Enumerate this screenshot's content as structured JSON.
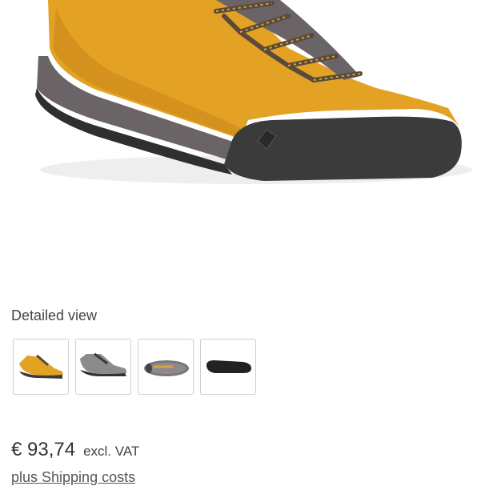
{
  "product": {
    "main_image_icon": "shoe-image",
    "colors": {
      "suede": "#E3A224",
      "suede_shadow": "#C9861A",
      "rubber": "#3B3B3B",
      "midsole": "#6B6466",
      "lace": "#5A4A3A",
      "lace_accent": "#D6A53A"
    }
  },
  "gallery": {
    "title": "Detailed view",
    "thumbnails": [
      {
        "icon": "shoe-side-yellow-thumbnail"
      },
      {
        "icon": "shoe-side-gray-thumbnail"
      },
      {
        "icon": "shoe-top-thumbnail"
      },
      {
        "icon": "shoe-sole-thumbnail"
      }
    ]
  },
  "pricing": {
    "price": "€ 93,74",
    "vat_note": "excl. VAT",
    "shipping_link": "plus Shipping costs"
  }
}
